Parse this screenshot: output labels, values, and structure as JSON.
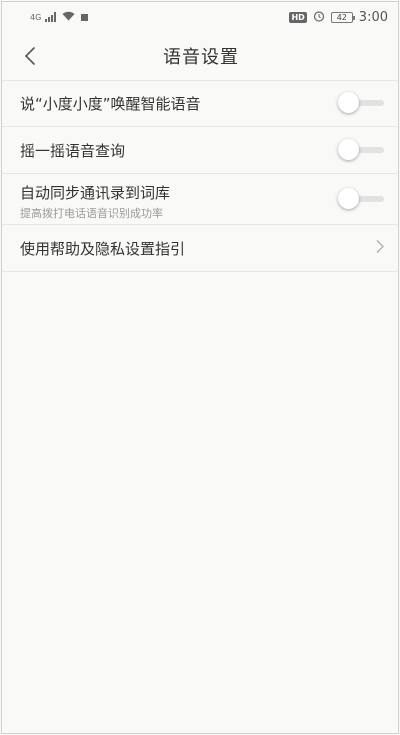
{
  "status_bar": {
    "network_label": "4G",
    "hd_label": "HD",
    "battery_level": "42",
    "time": "3:00"
  },
  "nav": {
    "title": "语音设置",
    "back_icon": "chevron-left-icon"
  },
  "settings": [
    {
      "label": "说“小度小度”唤醒智能语音",
      "toggle": false
    },
    {
      "label": "摇一摇语音查询",
      "toggle": false
    },
    {
      "label": "自动同步通讯录到词库",
      "sublabel": "提高拨打电话语音识别成功率",
      "toggle": false
    },
    {
      "label": "使用帮助及隐私设置指引",
      "has_chevron": true
    }
  ]
}
